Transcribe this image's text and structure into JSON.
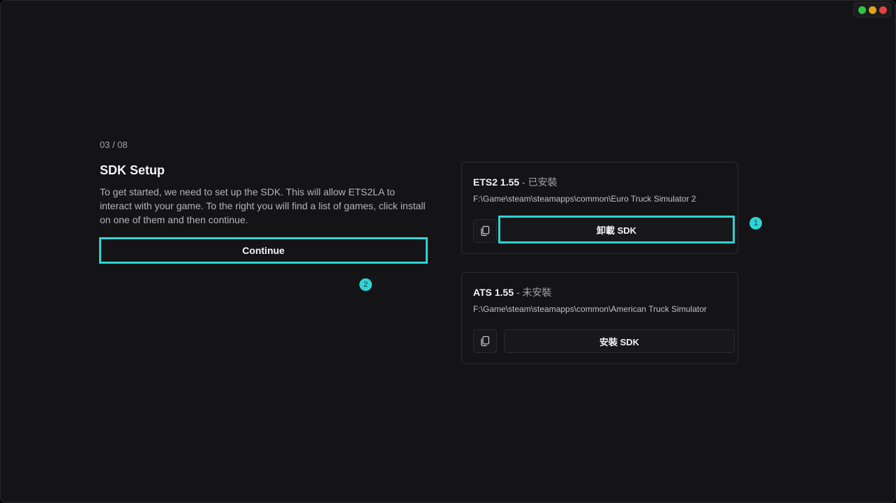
{
  "window": {
    "controls": [
      {
        "name": "green",
        "color": "#27c93f"
      },
      {
        "name": "yellow",
        "color": "#e0a21b"
      },
      {
        "name": "red",
        "color": "#e0443e"
      }
    ]
  },
  "setup": {
    "step": "03 / 08",
    "title": "SDK Setup",
    "description": "To get started, we need to set up the SDK. This will allow ETS2LA to interact with your game. To the right you will find a list of games, click install on one of them and then continue.",
    "continue_label": "Continue"
  },
  "games": [
    {
      "name": "ETS2 1.55",
      "status": " - 已安裝",
      "path": "F:\\Game\\steam\\steamapps\\common\\Euro Truck Simulator 2",
      "button_label": "卸載 SDK",
      "copy_icon": "copy-icon"
    },
    {
      "name": "ATS 1.55",
      "status": " - 未安裝",
      "path": "F:\\Game\\steam\\steamapps\\common\\American Truck Simulator",
      "button_label": "安裝 SDK",
      "copy_icon": "copy-icon"
    }
  ],
  "annotations": {
    "badge_1": "1",
    "badge_2": "2",
    "highlight_color": "#2fd3d3"
  }
}
